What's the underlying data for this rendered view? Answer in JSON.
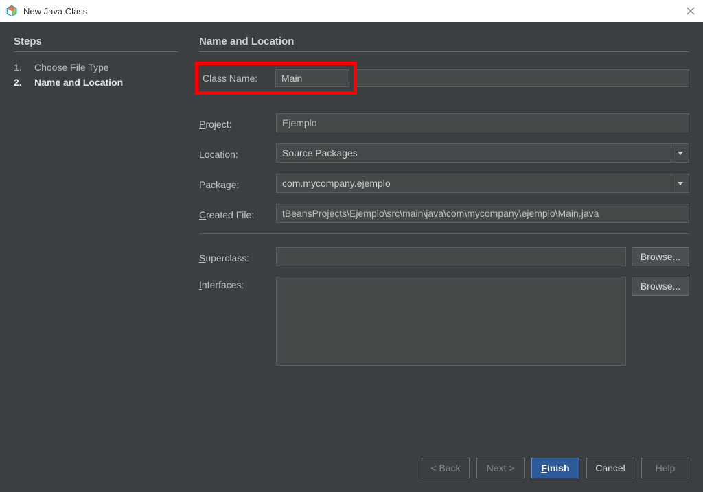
{
  "window": {
    "title": "New Java Class"
  },
  "sidebar": {
    "heading": "Steps",
    "steps": [
      {
        "num": "1.",
        "label": "Choose File Type"
      },
      {
        "num": "2.",
        "label": "Name and Location"
      }
    ]
  },
  "main": {
    "heading": "Name and Location",
    "labels": {
      "class_name": "Class Name:",
      "project": "Project:",
      "location": "Location:",
      "package": "Package:",
      "created_file": "Created File:",
      "superclass": "Superclass:",
      "interfaces": "Interfaces:"
    },
    "values": {
      "class_name": "Main",
      "project": "Ejemplo",
      "location": "Source Packages",
      "package": "com.mycompany.ejemplo",
      "created_file": "tBeansProjects\\Ejemplo\\src\\main\\java\\com\\mycompany\\ejemplo\\Main.java",
      "superclass": "",
      "interfaces": ""
    },
    "browse_label": "Browse..."
  },
  "buttons": {
    "back": "< Back",
    "next": "Next >",
    "finish": "Finish",
    "cancel": "Cancel",
    "help": "Help"
  }
}
